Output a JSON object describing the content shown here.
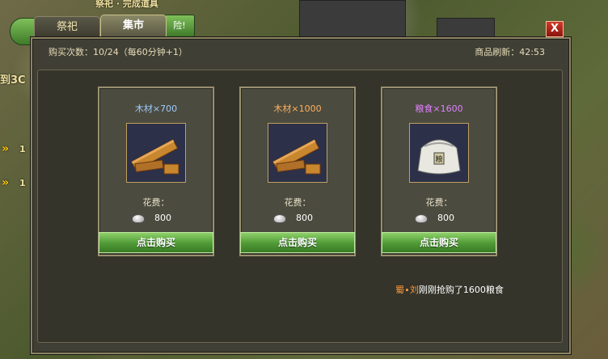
{
  "window": {
    "tabs": [
      {
        "label": "祭祀",
        "active": false
      },
      {
        "label": "集市",
        "active": true
      }
    ],
    "close_label": "X"
  },
  "header": {
    "buy_count": "购买次数：10/24（每60分钟+1）",
    "refresh": "商品刷新：42:53"
  },
  "items": [
    {
      "title": "木材×700",
      "title_color": "#9ecbff",
      "icon": "wood-planks-icon",
      "cost_label": "花费：",
      "cost_currency": "silver-icon",
      "cost": "800",
      "buy_label": "点击购买"
    },
    {
      "title": "木材×1000",
      "title_color": "#ffb060",
      "icon": "wood-planks-icon",
      "cost_label": "花费：",
      "cost_currency": "silver-icon",
      "cost": "800",
      "buy_label": "点击购买"
    },
    {
      "title": "粮食×1600",
      "title_color": "#e080ff",
      "icon": "grain-sack-icon",
      "cost_label": "花费：",
      "cost_currency": "silver-icon",
      "cost": "800",
      "buy_label": "点击购买"
    }
  ],
  "news": {
    "player": "蜀∙刘",
    "message": "刚刚抢购了1600粮食"
  },
  "background": {
    "fragment_top": "祭祀 · 完成道具",
    "fragment_left": "到3C",
    "pill_text": "险!",
    "counter_1": "1",
    "counter_2": "1"
  }
}
